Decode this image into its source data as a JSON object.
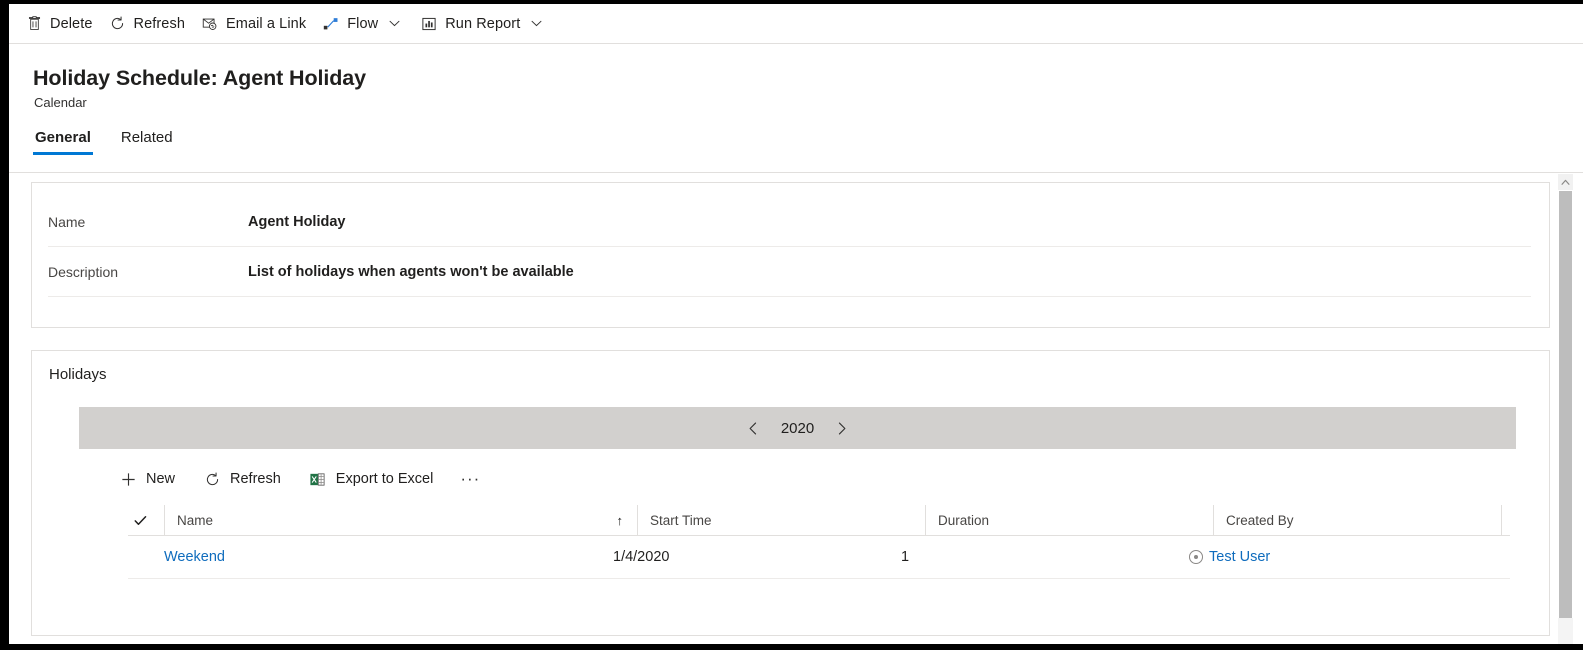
{
  "command_bar": {
    "buttons": [
      {
        "label": "Delete",
        "icon": "trash-icon",
        "caret": false
      },
      {
        "label": "Refresh",
        "icon": "refresh-icon",
        "caret": false
      },
      {
        "label": "Email a Link",
        "icon": "email-link-icon",
        "caret": false
      },
      {
        "label": "Flow",
        "icon": "flow-icon",
        "caret": true
      },
      {
        "label": "Run Report",
        "icon": "run-report-icon",
        "caret": true
      }
    ]
  },
  "header": {
    "title": "Holiday Schedule: Agent Holiday",
    "subtitle": "Calendar",
    "tabs": [
      {
        "label": "General",
        "selected": true
      },
      {
        "label": "Related",
        "selected": false
      }
    ]
  },
  "general_section": {
    "fields": [
      {
        "label": "Name",
        "value": "Agent Holiday"
      },
      {
        "label": "Description",
        "value": "List of holidays when agents won't be available"
      }
    ]
  },
  "holidays_section": {
    "heading": "Holidays",
    "year_nav": {
      "prev_icon": "chevron-left-icon",
      "year": "2020",
      "next_icon": "chevron-right-icon"
    },
    "toolbar": [
      {
        "label": "New",
        "icon": "plus-icon"
      },
      {
        "label": "Refresh",
        "icon": "refresh-icon"
      },
      {
        "label": "Export to Excel",
        "icon": "excel-icon"
      }
    ],
    "overflow_label": "···",
    "grid": {
      "select_all_icon": "checkmark-icon",
      "columns": [
        {
          "label": "Name",
          "sort": "↑"
        },
        {
          "label": "Start Time",
          "sort": ""
        },
        {
          "label": "Duration",
          "sort": ""
        },
        {
          "label": "Created By",
          "sort": ""
        }
      ],
      "rows": [
        {
          "name": "Weekend",
          "start_time": "1/4/2020",
          "duration": "1",
          "created_by": "Test User",
          "created_by_icon": "contact-avatar-icon"
        }
      ]
    }
  },
  "scrollbar": {
    "up_icon": "scroll-up-arrow-icon"
  },
  "colors": {
    "accent": "#0078d4",
    "link": "#0f6cbd",
    "year_bar": "#d2d0ce",
    "excel_green": "#217346",
    "frame": "#000000"
  }
}
